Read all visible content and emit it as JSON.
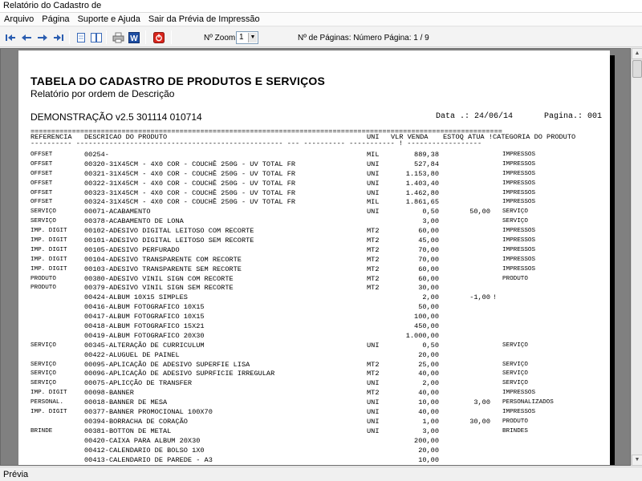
{
  "window": {
    "title": "Relatório do Cadastro de"
  },
  "menu": [
    "Arquivo",
    "Página",
    "Suporte e Ajuda",
    "Sair da Prévia de Impressão"
  ],
  "toolbar": {
    "zoom_label": "Nº Zoom",
    "zoom_value": "1",
    "pages_label": "Nº de Páginas: Número Página: 1 / 9",
    "buttons": [
      {
        "name": "first-page-icon",
        "glyph": "◀|"
      },
      {
        "name": "previous-page-icon",
        "glyph": "◀"
      },
      {
        "name": "next-page-icon",
        "glyph": "▶"
      },
      {
        "name": "last-page-icon",
        "glyph": "|▶"
      },
      {
        "name": "single-page-icon",
        "glyph": "▯"
      },
      {
        "name": "two-pages-icon",
        "glyph": "▯▯"
      },
      {
        "name": "print-icon",
        "glyph": "⎙"
      },
      {
        "name": "word-export-icon",
        "glyph": "W"
      },
      {
        "name": "close-preview-icon",
        "glyph": "⏻"
      }
    ]
  },
  "report": {
    "title": "TABELA DO CADASTRO DE PRODUTOS E SERVIÇOS",
    "subtitle": "Relatório por ordem de Descrição",
    "company": "DEMONSTRAÇÃO v2.5 301114 010714",
    "date": "Data .: 24/06/14",
    "page": "Pagina.: 001",
    "rule": "==================================================================================================================",
    "headers": {
      "ref": "REFERENCIA",
      "desc": "DESCRICAO DO PRODUTO",
      "uni": "UNI",
      "vlr": "VLR VENDA",
      "est": "ESTOQ ATUA !",
      "cat": "CATEGORIA DO PRODUTO"
    },
    "dashes": "---------- -------------------------------------------------- --- ---------- ----------- ! ------------------",
    "rows": [
      {
        "ref": "OFFSET",
        "desc": "00254-",
        "uni": "MIL",
        "vlr": "889,38",
        "est": "",
        "ex": "",
        "cat": "IMPRESSOS"
      },
      {
        "ref": "OFFSET",
        "desc": "00320-31X45CM - 4X0 COR - COUCHÊ 250G - UV TOTAL FR",
        "uni": "UNI",
        "vlr": "527,84",
        "est": "",
        "ex": "",
        "cat": "IMPRESSOS"
      },
      {
        "ref": "OFFSET",
        "desc": "00321-31X45CM - 4X0 COR - COUCHÊ 250G - UV TOTAL FR",
        "uni": "UNI",
        "vlr": "1.153,80",
        "est": "",
        "ex": "",
        "cat": "IMPRESSOS"
      },
      {
        "ref": "OFFSET",
        "desc": "00322-31X45CM - 4X0 COR - COUCHÊ 250G - UV TOTAL FR",
        "uni": "UNI",
        "vlr": "1.403,40",
        "est": "",
        "ex": "",
        "cat": "IMPRESSOS"
      },
      {
        "ref": "OFFSET",
        "desc": "00323-31X45CM - 4X0 COR - COUCHÊ 250G - UV TOTAL FR",
        "uni": "UNI",
        "vlr": "1.462,80",
        "est": "",
        "ex": "",
        "cat": "IMPRESSOS"
      },
      {
        "ref": "OFFSET",
        "desc": "00324-31X45CM - 4X0 COR - COUCHÊ 250G - UV TOTAL FR",
        "uni": "MIL",
        "vlr": "1.861,65",
        "est": "",
        "ex": "",
        "cat": "IMPRESSOS"
      },
      {
        "ref": "SERVIÇO",
        "desc": "00071-ACABAMENTO",
        "uni": "UNI",
        "vlr": "0,50",
        "est": "50,00",
        "ex": "",
        "cat": "SERVIÇO"
      },
      {
        "ref": "SERVIÇO",
        "desc": "00378-ACABAMENTO DE LONA",
        "uni": "",
        "vlr": "3,00",
        "est": "",
        "ex": "",
        "cat": "SERVIÇO"
      },
      {
        "ref": "IMP. DIGIT",
        "desc": "00102-ADESIVO DIGITAL LEITOSO COM RECORTE",
        "uni": "MT2",
        "vlr": "60,00",
        "est": "",
        "ex": "",
        "cat": "IMPRESSOS"
      },
      {
        "ref": "IMP. DIGIT",
        "desc": "00101-ADESIVO DIGITAL LEITOSO SEM RECORTE",
        "uni": "MT2",
        "vlr": "45,00",
        "est": "",
        "ex": "",
        "cat": "IMPRESSOS"
      },
      {
        "ref": "IMP. DIGIT",
        "desc": "00105-ADESIVO PERFURADO",
        "uni": "MT2",
        "vlr": "70,00",
        "est": "",
        "ex": "",
        "cat": "IMPRESSOS"
      },
      {
        "ref": "IMP. DIGIT",
        "desc": "00104-ADESIVO TRANSPARENTE COM RECORTE",
        "uni": "MT2",
        "vlr": "70,00",
        "est": "",
        "ex": "",
        "cat": "IMPRESSOS"
      },
      {
        "ref": "IMP. DIGIT",
        "desc": "00103-ADESIVO TRANSPARENTE SEM RECORTE",
        "uni": "MT2",
        "vlr": "60,00",
        "est": "",
        "ex": "",
        "cat": "IMPRESSOS"
      },
      {
        "ref": "PRODUTO",
        "desc": "00380-ADESIVO VINIL SIGN COM RECORTE",
        "uni": "MT2",
        "vlr": "60,00",
        "est": "",
        "ex": "",
        "cat": "PRODUTO"
      },
      {
        "ref": "PRODUTO",
        "desc": "00379-ADESIVO VINIL SIGN SEM RECORTE",
        "uni": "MT2",
        "vlr": "30,00",
        "est": "",
        "ex": "",
        "cat": ""
      },
      {
        "ref": "",
        "desc": "00424-ALBUM 10X15 SIMPLES",
        "uni": "",
        "vlr": "2,00",
        "est": "-1,00",
        "ex": "!",
        "cat": ""
      },
      {
        "ref": "",
        "desc": "00416-ALBUM FOTOGRAFICO 10X15",
        "uni": "",
        "vlr": "50,00",
        "est": "",
        "ex": "",
        "cat": ""
      },
      {
        "ref": "",
        "desc": "00417-ALBUM FOTOGRAFICO 10X15",
        "uni": "",
        "vlr": "100,00",
        "est": "",
        "ex": "",
        "cat": ""
      },
      {
        "ref": "",
        "desc": "00418-ALBUM FOTOGRAFICO 15X21",
        "uni": "",
        "vlr": "450,00",
        "est": "",
        "ex": "",
        "cat": ""
      },
      {
        "ref": "",
        "desc": "00419-ALBUM FOTOGRAFICO 20X30",
        "uni": "",
        "vlr": "1.000,00",
        "est": "",
        "ex": "",
        "cat": ""
      },
      {
        "ref": "SERVIÇO",
        "desc": "00345-ALTERAÇÃO DE CURRICULUM",
        "uni": "UNI",
        "vlr": "0,50",
        "est": "",
        "ex": "",
        "cat": "SERVIÇO"
      },
      {
        "ref": "",
        "desc": "00422-ALUGUEL DE PAINEL",
        "uni": "",
        "vlr": "20,00",
        "est": "",
        "ex": "",
        "cat": ""
      },
      {
        "ref": "SERVIÇO",
        "desc": "00095-APLICAÇÃO DE ADESIVO SUPERFIE LISA",
        "uni": "MT2",
        "vlr": "25,00",
        "est": "",
        "ex": "",
        "cat": "SERVIÇO"
      },
      {
        "ref": "SERVIÇO",
        "desc": "00096-APLICAÇÃO DE ADESIVO SUPRFICIE IRREGULAR",
        "uni": "MT2",
        "vlr": "40,00",
        "est": "",
        "ex": "",
        "cat": "SERVIÇO"
      },
      {
        "ref": "SERVIÇO",
        "desc": "00075-APLICÇÃO DE TRANSFER",
        "uni": "UNI",
        "vlr": "2,00",
        "est": "",
        "ex": "",
        "cat": "SERVIÇO"
      },
      {
        "ref": "IMP. DIGIT",
        "desc": "00098-BANNER",
        "uni": "MT2",
        "vlr": "40,00",
        "est": "",
        "ex": "",
        "cat": "IMPRESSOS"
      },
      {
        "ref": "PERSONAL.",
        "desc": "00018-BANNER DE MESA",
        "uni": "UNI",
        "vlr": "10,00",
        "est": "3,00",
        "ex": "",
        "cat": "PERSONALIZADOS"
      },
      {
        "ref": "IMP. DIGIT",
        "desc": "00377-BANNER PROMOCIONAL 100X70",
        "uni": "UNI",
        "vlr": "40,00",
        "est": "",
        "ex": "",
        "cat": "IMPRESSOS"
      },
      {
        "ref": "",
        "desc": "00394-BORRACHA DE CORAÇÃO",
        "uni": "UNI",
        "vlr": "1,00",
        "est": "30,00",
        "ex": "",
        "cat": "PRODUTO"
      },
      {
        "ref": "BRINDE",
        "desc": "00381-BOTTON DE METAL",
        "uni": "UNI",
        "vlr": "3,00",
        "est": "",
        "ex": "",
        "cat": "BRINDES"
      },
      {
        "ref": "",
        "desc": "00420-CAIXA PARA ALBUM 20X30",
        "uni": "",
        "vlr": "200,00",
        "est": "",
        "ex": "",
        "cat": ""
      },
      {
        "ref": "",
        "desc": "00412-CALENDARIO DE BOLSO 1X0",
        "uni": "",
        "vlr": "20,00",
        "est": "",
        "ex": "",
        "cat": ""
      },
      {
        "ref": "",
        "desc": "00413-CALENDARIO DE PAREDE - A3",
        "uni": "",
        "vlr": "10,00",
        "est": "",
        "ex": "",
        "cat": ""
      }
    ]
  },
  "status": {
    "text": "Prévia"
  }
}
